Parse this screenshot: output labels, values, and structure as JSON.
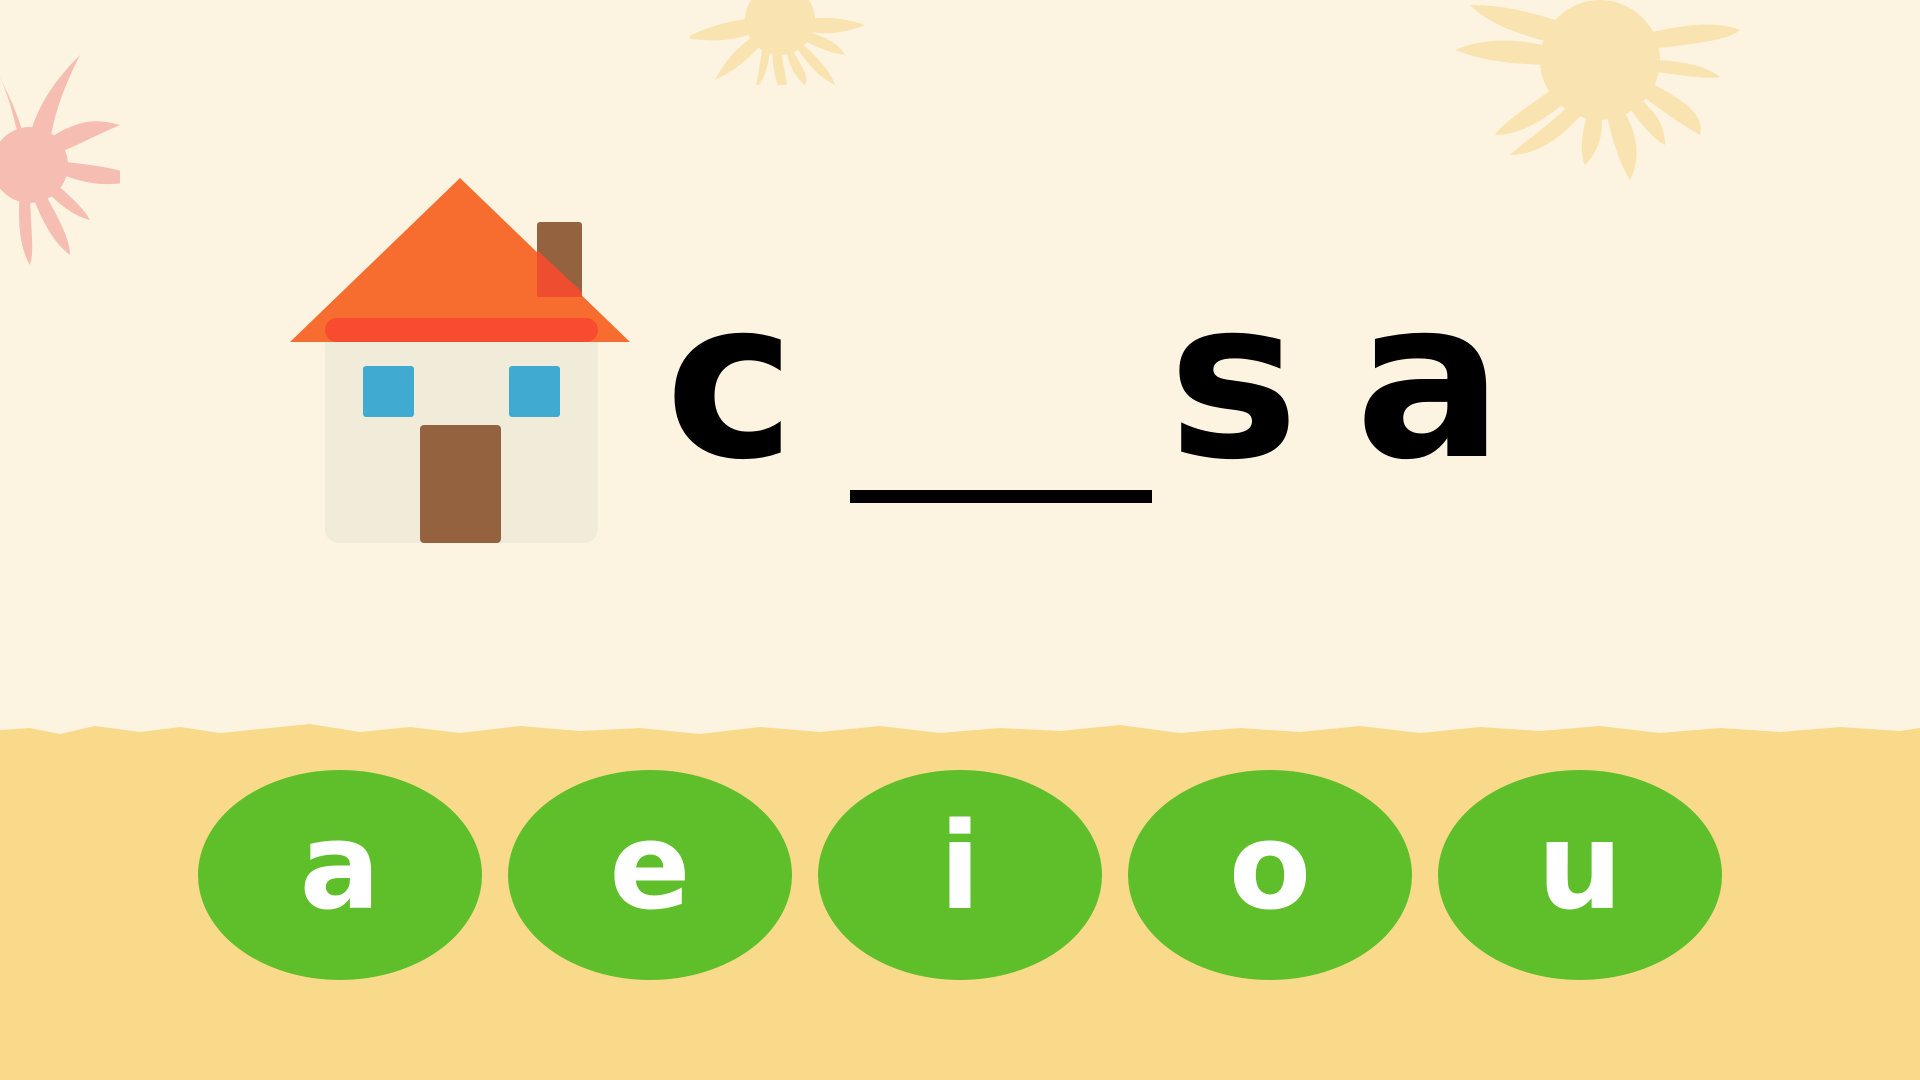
{
  "colors": {
    "background": "#FDF3E1",
    "ground": "#F9DA8A",
    "choice_fill": "#5FBF2A",
    "choice_text": "#FFFFFF",
    "word_text": "#000000",
    "roof": "#F76C2F",
    "roof_trim": "#F84B2F",
    "house_wall": "#F1EBDA",
    "house_window": "#41AAD0",
    "house_door": "#956240",
    "flower_pink": "#F6BDB3",
    "flower_yellow": "#F9E4B1"
  },
  "icons": {
    "picture": "house-icon"
  },
  "word": {
    "before_blank": "c",
    "after_blank_1": "s",
    "after_blank_2": "a"
  },
  "choices": [
    {
      "label": "a"
    },
    {
      "label": "e"
    },
    {
      "label": "i"
    },
    {
      "label": "o"
    },
    {
      "label": "u"
    }
  ]
}
